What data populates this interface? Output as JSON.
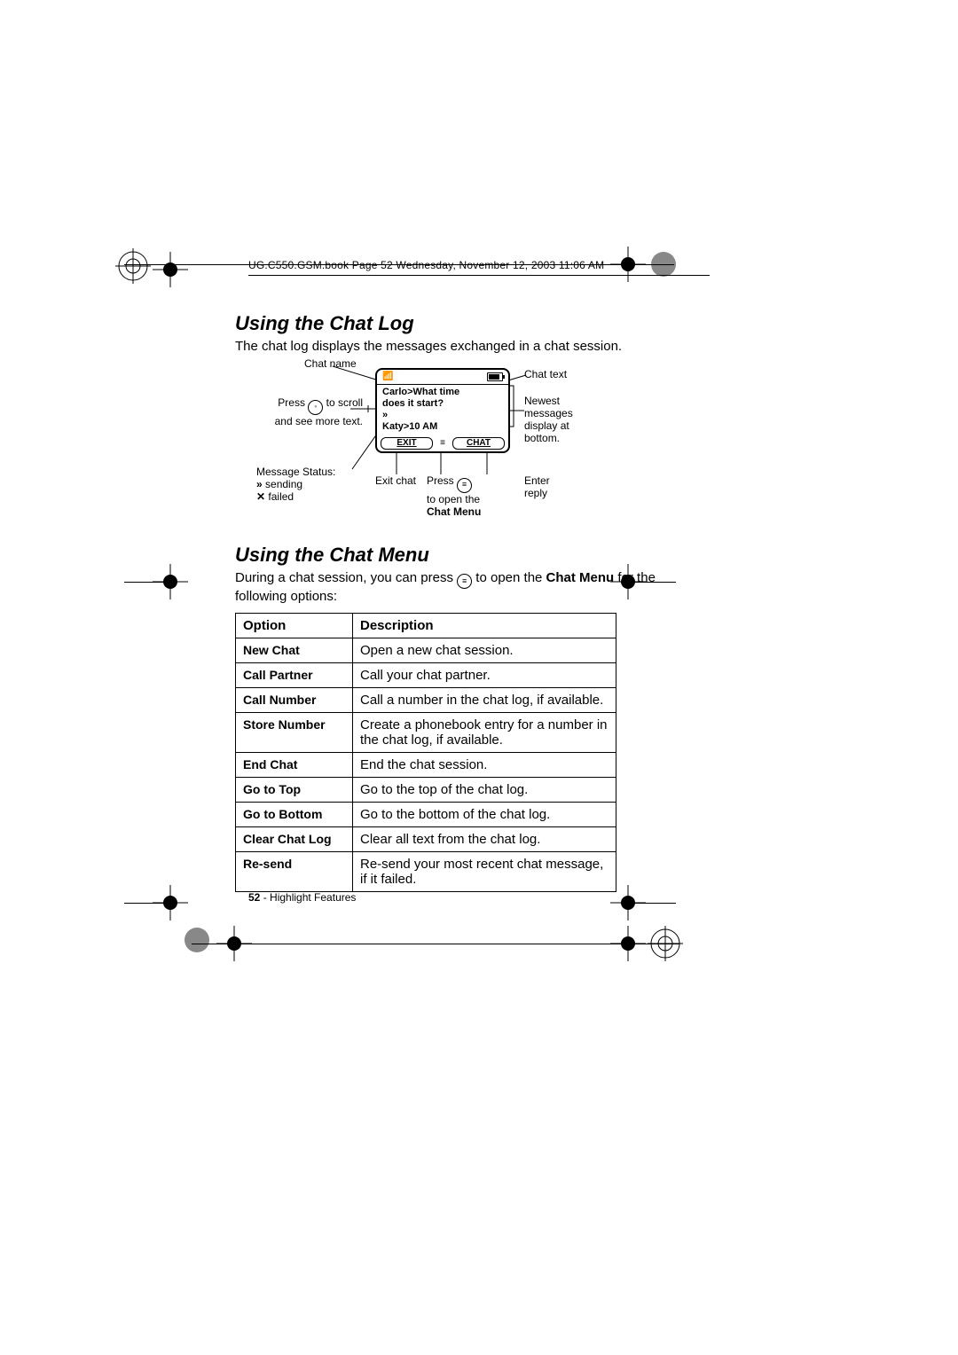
{
  "page_header": "UG.C550.GSM.book  Page 52  Wednesday, November 12, 2003  11:06 AM",
  "section1": {
    "heading": "Using the Chat Log",
    "intro": "The chat log displays the messages exchanged in a chat session."
  },
  "diagram": {
    "chat_name_label": "Chat name",
    "scroll_hint_pre": "Press ",
    "scroll_hint_post": " to scroll and see more text.",
    "status_label": "Message Status:",
    "status_sending": "sending",
    "status_failed": "failed",
    "exit_chat_label": "Exit chat",
    "open_menu_pre": "Press ",
    "open_menu_post": "to open the ",
    "open_menu_strong": "Chat Menu",
    "chat_text_label": "Chat text",
    "newest_label": "Newest messages display at bottom.",
    "enter_reply_label": "Enter reply",
    "screen": {
      "line1": "Carlo>What time",
      "line2": "does it start?",
      "line3_prefix": "»",
      "line3": "Katy>10 AM",
      "soft_left": "EXIT",
      "soft_right": "CHAT"
    }
  },
  "section2": {
    "heading": "Using the Chat Menu",
    "intro_pre": "During a chat session, you can press ",
    "intro_mid": " to open the ",
    "intro_strong": "Chat Menu",
    "intro_post": " for the following options:"
  },
  "table": {
    "col_option": "Option",
    "col_desc": "Description",
    "rows": [
      {
        "option": "New Chat",
        "desc": "Open a new chat session."
      },
      {
        "option": "Call Partner",
        "desc": "Call your chat partner."
      },
      {
        "option": "Call Number",
        "desc": "Call a number in the chat log, if available."
      },
      {
        "option": "Store Number",
        "desc": "Create a phonebook entry for a number in the chat log, if available."
      },
      {
        "option": "End Chat",
        "desc": "End the chat session."
      },
      {
        "option": "Go to Top",
        "desc": "Go to the top of the chat log."
      },
      {
        "option": "Go to Bottom",
        "desc": "Go to the bottom of the chat log."
      },
      {
        "option": "Clear Chat Log",
        "desc": "Clear all text from the chat log."
      },
      {
        "option": "Re-send",
        "desc": "Re-send your most recent chat message, if it failed."
      }
    ]
  },
  "footer": {
    "page_num": "52",
    "section": " - Highlight Features"
  }
}
